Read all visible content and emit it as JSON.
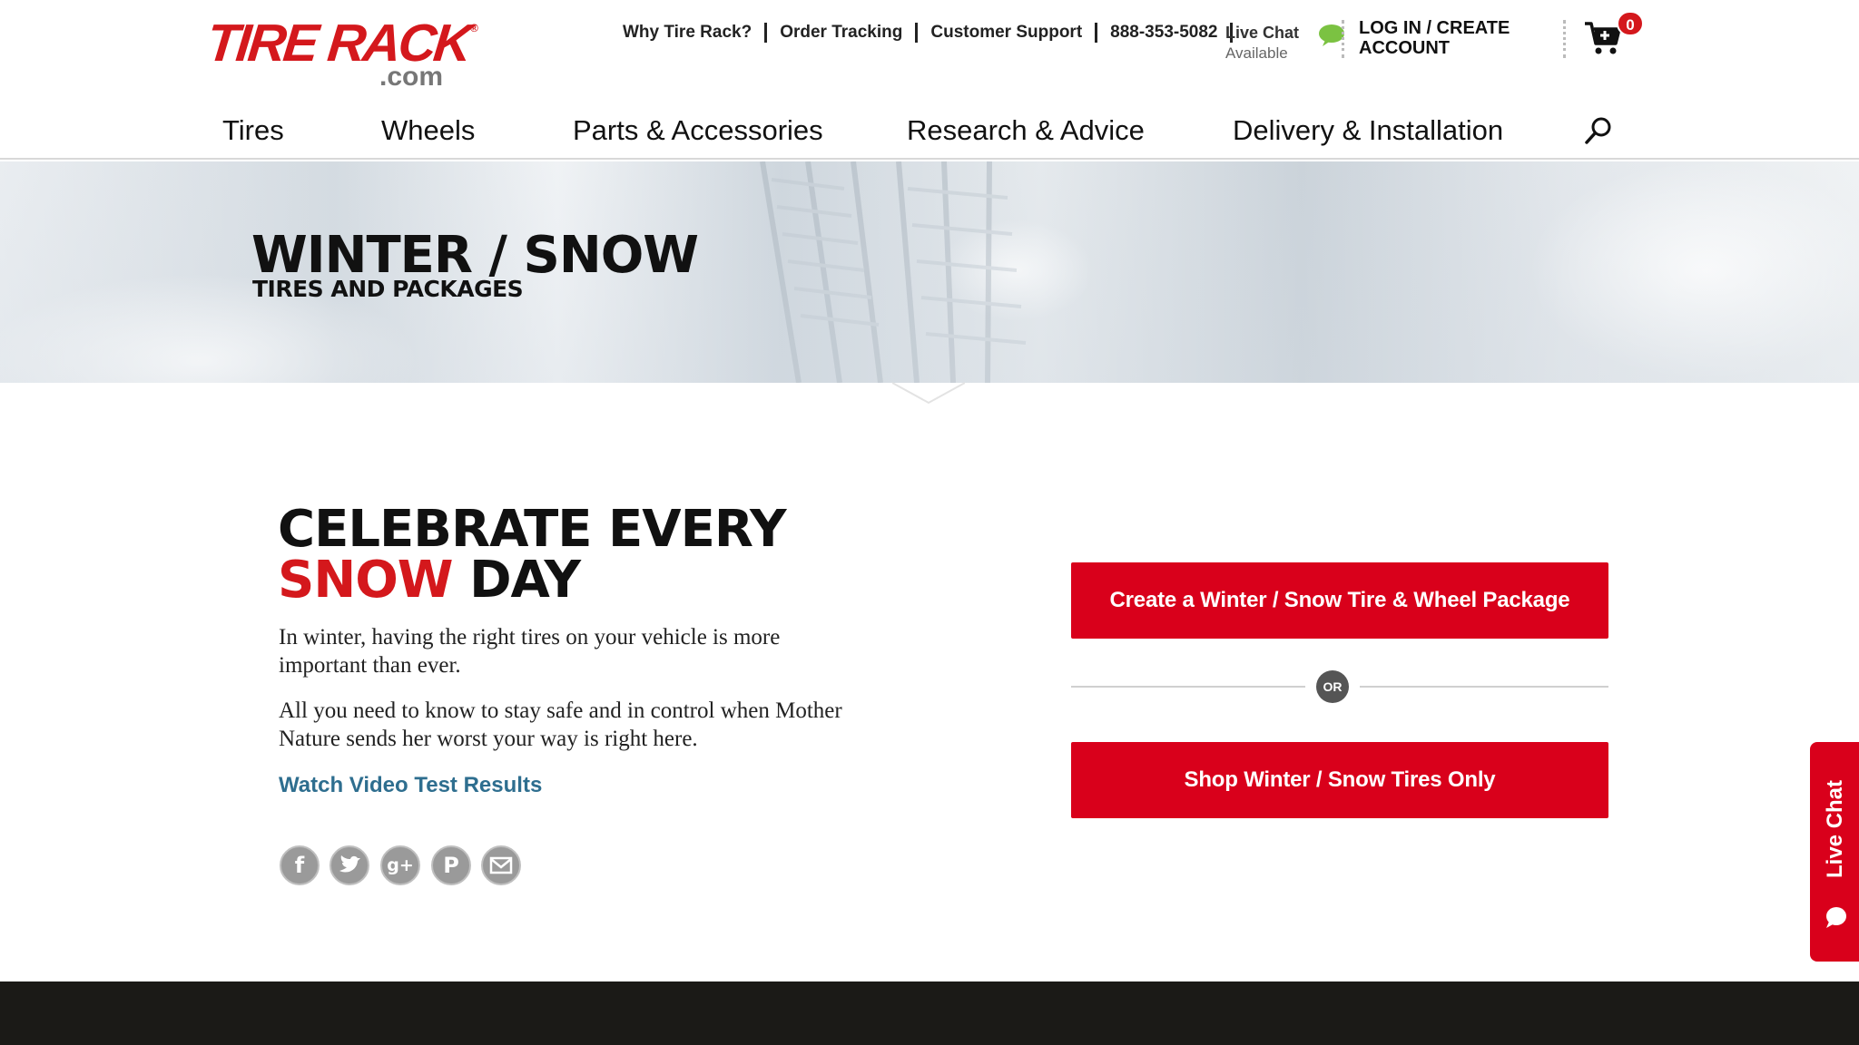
{
  "header": {
    "logo": {
      "brand": "TIRE RACK",
      "suffix": ".com",
      "reg": "®"
    },
    "utility_links": [
      "Why Tire Rack?",
      "Order Tracking",
      "Customer Support",
      "888-353-5082"
    ],
    "live_chat": {
      "label": "Live Chat",
      "status": "Available"
    },
    "login": "LOG IN / CREATE ACCOUNT",
    "cart_count": "0",
    "nav": [
      "Tires",
      "Wheels",
      "Parts & Accessories",
      "Research & Advice",
      "Delivery & Installation"
    ]
  },
  "hero": {
    "title": "WINTER / SNOW",
    "subtitle": "TIRES AND PACKAGES"
  },
  "main": {
    "headline_line1": "CELEBRATE EVERY",
    "headline_red": "SNOW",
    "headline_rest": " DAY",
    "paragraph1": "In winter, having the right tires on your vehicle is more important than ever.",
    "paragraph2": "All you need to know to stay safe and in control when Mother Nature sends her worst your way is right here.",
    "video_link": "Watch Video Test Results",
    "social_icons": [
      "facebook-icon",
      "twitter-icon",
      "google-plus-icon",
      "pinterest-icon",
      "email-icon"
    ]
  },
  "actions": {
    "package_button": "Create a Winter / Snow Tire & Wheel Package",
    "or_label": "OR",
    "tires_button": "Shop Winter / Snow Tires Only"
  },
  "side_chat": {
    "label": "Live Chat"
  },
  "colors": {
    "brand_red": "#d4181c",
    "button_red": "#d9001b",
    "link_blue": "#2e6e8f",
    "footer": "#1b1a17"
  }
}
